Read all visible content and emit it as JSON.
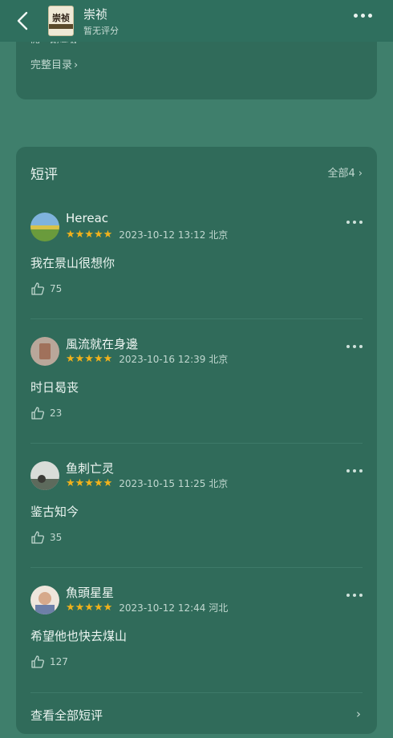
{
  "header": {
    "book_title": "崇祯",
    "rating_text": "暂无评分",
    "cover_text": "崇祯"
  },
  "toc": {
    "partial_line": "四，极崇从……",
    "link_label": "完整目录"
  },
  "reviews": {
    "title": "短评",
    "all_label": "全部4",
    "items": [
      {
        "name": "Hereac",
        "stars": "★★★★★",
        "date": "2023-10-12 13:12",
        "location": "北京",
        "text": "我在景山很想你",
        "likes": "75"
      },
      {
        "name": "風流就在身邊",
        "stars": "★★★★★",
        "date": "2023-10-16 12:39",
        "location": "北京",
        "text": "时日曷丧",
        "likes": "23"
      },
      {
        "name": "鱼刺亡灵",
        "stars": "★★★★★",
        "date": "2023-10-15 11:25",
        "location": "北京",
        "text": "鉴古知今",
        "likes": "35"
      },
      {
        "name": "魚頭星星",
        "stars": "★★★★★",
        "date": "2023-10-12 12:44",
        "location": "河北",
        "text": "希望他也快去煤山",
        "likes": "127"
      }
    ],
    "view_all_label": "查看全部短评"
  },
  "colors": {
    "background": "#3f7f6c",
    "card": "#306b5a",
    "star": "#f2b21b"
  }
}
